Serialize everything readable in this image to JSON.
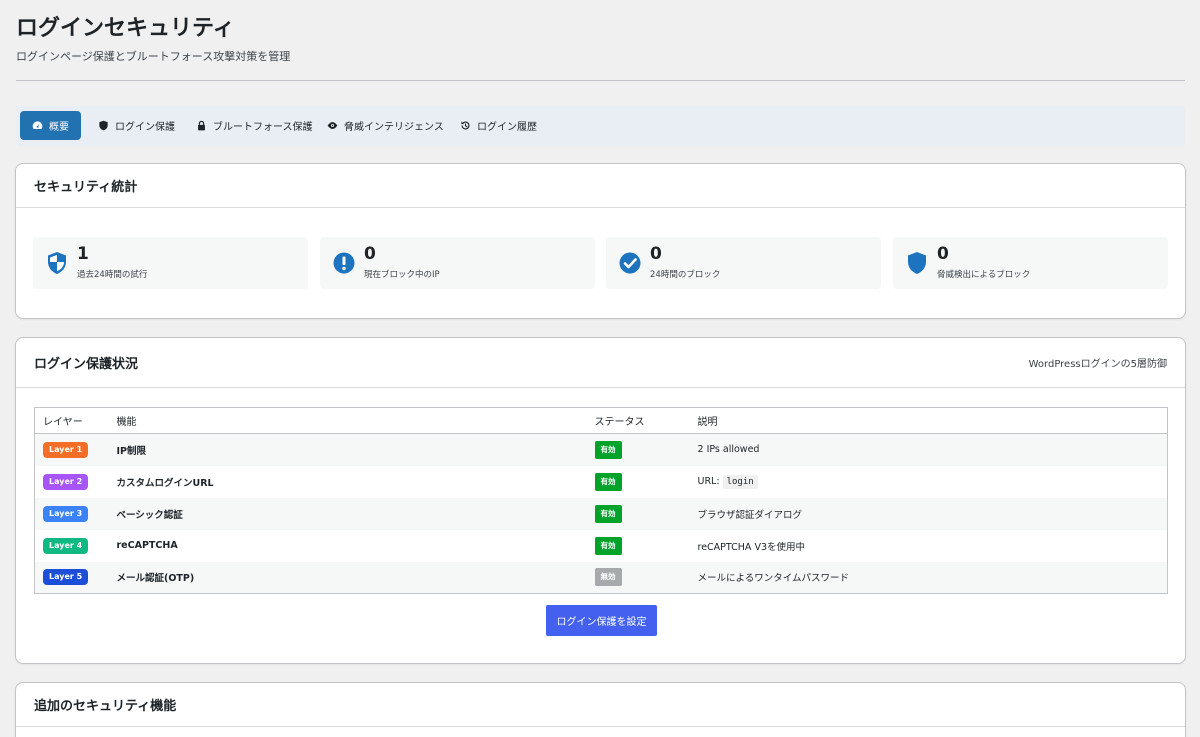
{
  "header": {
    "title": "ログインセキュリティ",
    "subtitle": "ログインページ保護とブルートフォース攻撃対策を管理"
  },
  "tabs": [
    {
      "label": "概要",
      "icon": "dashboard-icon",
      "active": true
    },
    {
      "label": "ログイン保護",
      "icon": "shield-icon",
      "active": false
    },
    {
      "label": "ブルートフォース保護",
      "icon": "lock-icon",
      "active": false
    },
    {
      "label": "脅威インテリジェンス",
      "icon": "eye-icon",
      "active": false
    },
    {
      "label": "ログイン履歴",
      "icon": "history-icon",
      "active": false
    }
  ],
  "stats_card": {
    "title": "セキュリティ統計",
    "items": [
      {
        "value": "1",
        "label": "過去24時間の試行",
        "icon": "shield-half-icon"
      },
      {
        "value": "0",
        "label": "現在ブロック中のIP",
        "icon": "exclamation-circle-icon"
      },
      {
        "value": "0",
        "label": "24時間のブロック",
        "icon": "check-circle-icon"
      },
      {
        "value": "0",
        "label": "脅威検出によるブロック",
        "icon": "shield-icon"
      }
    ]
  },
  "protection_card": {
    "title": "ログイン保護状況",
    "note": "WordPressログインの5層防御",
    "columns": [
      "レイヤー",
      "機能",
      "ステータス",
      "説明"
    ],
    "rows": [
      {
        "layer": "Layer 1",
        "layer_color": "#f56e28",
        "feature": "IP制限",
        "status": "有効",
        "status_color": "#00a32a",
        "description": "2 IPs allowed",
        "code": ""
      },
      {
        "layer": "Layer 2",
        "layer_color": "#a855f7",
        "feature": "カスタムログインURL",
        "status": "有効",
        "status_color": "#00a32a",
        "description": "URL: ",
        "code": "login"
      },
      {
        "layer": "Layer 3",
        "layer_color": "#3b82f6",
        "feature": "ベーシック認証",
        "status": "有効",
        "status_color": "#00a32a",
        "description": "ブラウザ認証ダイアログ",
        "code": ""
      },
      {
        "layer": "Layer 4",
        "layer_color": "#10b981",
        "feature": "reCAPTCHA",
        "status": "有効",
        "status_color": "#00a32a",
        "description": "reCAPTCHA V3を使用中",
        "code": ""
      },
      {
        "layer": "Layer 5",
        "layer_color": "#1d4ed8",
        "feature": "メール認証(OTP)",
        "status": "無効",
        "status_color": "#a7aaad",
        "description": "メールによるワンタイムパスワード",
        "code": ""
      }
    ],
    "button_label": "ログイン保護を設定"
  },
  "additional_card": {
    "title": "追加のセキュリティ機能"
  },
  "colors": {
    "primary": "#2271b1",
    "icon_blue": "#1e73be",
    "button": "#4361ee",
    "enabled": "#00a32a",
    "disabled": "#a7aaad"
  }
}
